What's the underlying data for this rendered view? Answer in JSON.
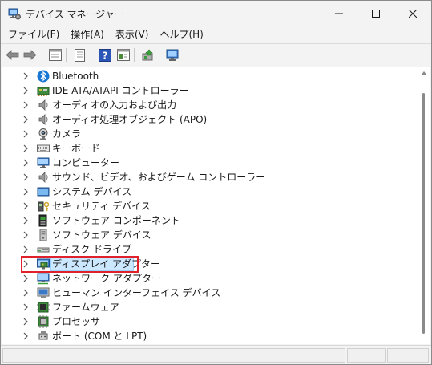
{
  "window": {
    "title": "デバイス マネージャー"
  },
  "menu": [
    {
      "label": "ファイル(F)"
    },
    {
      "label": "操作(A)"
    },
    {
      "label": "表示(V)"
    },
    {
      "label": "ヘルプ(H)"
    }
  ],
  "toolbar": {
    "icons": [
      "back-arrow-icon",
      "forward-arrow-icon",
      "properties-icon",
      "show-hidden-icon",
      "help-icon",
      "view-icon",
      "update-driver-icon",
      "scan-hardware-icon"
    ]
  },
  "tree": {
    "items": [
      {
        "label": "Bluetooth",
        "icon": "bluetooth-icon"
      },
      {
        "label": "IDE ATA/ATAPI コントローラー",
        "icon": "ide-controller-icon"
      },
      {
        "label": "オーディオの入力および出力",
        "icon": "speaker-icon"
      },
      {
        "label": "オーディオ処理オブジェクト (APO)",
        "icon": "speaker-icon"
      },
      {
        "label": "カメラ",
        "icon": "camera-icon"
      },
      {
        "label": "キーボード",
        "icon": "keyboard-icon"
      },
      {
        "label": "コンピューター",
        "icon": "computer-icon"
      },
      {
        "label": "サウンド、ビデオ、およびゲーム コントローラー",
        "icon": "speaker-icon"
      },
      {
        "label": "システム デバイス",
        "icon": "system-folder-icon"
      },
      {
        "label": "セキュリティ デバイス",
        "icon": "security-key-icon"
      },
      {
        "label": "ソフトウェア コンポーネント",
        "icon": "software-component-icon"
      },
      {
        "label": "ソフトウェア デバイス",
        "icon": "software-device-icon"
      },
      {
        "label": "ディスク ドライブ",
        "icon": "disk-drive-icon"
      },
      {
        "label": "ディスプレイ アダプター",
        "icon": "display-adapter-icon",
        "selected": true
      },
      {
        "label": "ネットワーク アダプター",
        "icon": "network-adapter-icon"
      },
      {
        "label": "ヒューマン インターフェイス デバイス",
        "icon": "hid-icon"
      },
      {
        "label": "ファームウェア",
        "icon": "firmware-icon"
      },
      {
        "label": "プロセッサ",
        "icon": "processor-icon"
      },
      {
        "label": "ポート (COM と LPT)",
        "icon": "port-icon"
      }
    ]
  },
  "colors": {
    "selection_bg": "#cce8ff",
    "selection_border": "#99d1ff",
    "highlight": "#e0202a"
  }
}
